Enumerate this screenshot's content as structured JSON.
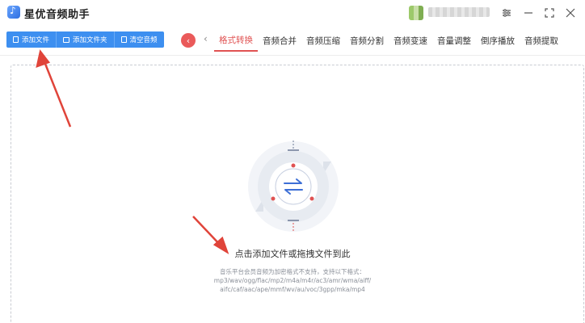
{
  "app": {
    "title": "星优音频助手"
  },
  "user": {
    "avatar_icon": "user-avatar-icon",
    "name_blurred": true
  },
  "window_controls": [
    "settings-icon",
    "minimize-icon",
    "maximize-icon",
    "close-icon"
  ],
  "toolbar": {
    "add_file": "添加文件",
    "add_folder": "添加文件夹",
    "clear_audio": "清空音频"
  },
  "tabs": [
    {
      "label": "格式转换",
      "active": true
    },
    {
      "label": "音频合并",
      "active": false
    },
    {
      "label": "音频压缩",
      "active": false
    },
    {
      "label": "音频分割",
      "active": false
    },
    {
      "label": "音频变速",
      "active": false
    },
    {
      "label": "音量调整",
      "active": false
    },
    {
      "label": "倒序播放",
      "active": false
    },
    {
      "label": "音频提取",
      "active": false
    }
  ],
  "main": {
    "drop_hint": "点击添加文件或拖拽文件到此",
    "formats_line1": "音乐平台会员音频为加密格式不支持，支持以下格式：",
    "formats_line2": "mp3/wav/ogg/flac/mp2/m4a/m4r/ac3/amr/wma/aiff/",
    "formats_line3": "aifc/caf/aac/ape/mmf/wv/au/voc/3gpp/mka/mp4"
  },
  "colors": {
    "accent_blue": "#3d8ff0",
    "accent_red": "#e05252",
    "arrow_red": "#e0443a"
  }
}
